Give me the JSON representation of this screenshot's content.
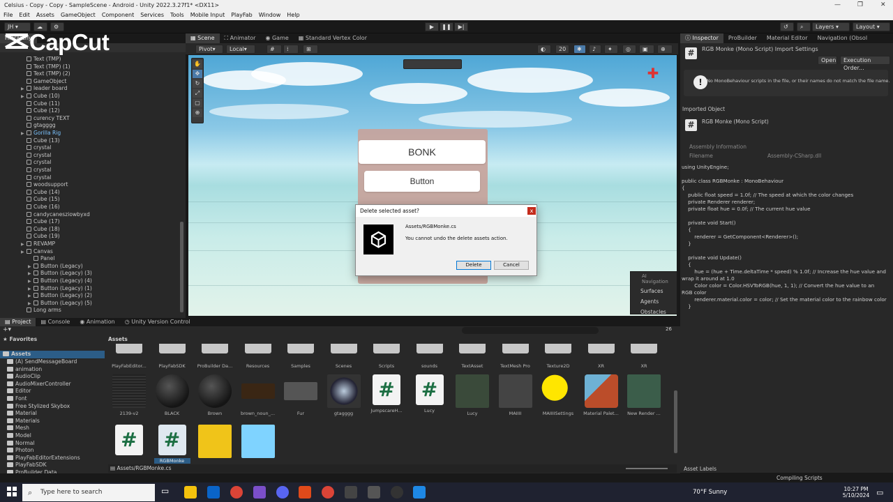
{
  "window": {
    "title": "Celsius - Copy - Copy - SampleScene - Android - Unity 2022.3.27f1* <DX11>"
  },
  "menu": [
    "File",
    "Edit",
    "Assets",
    "GameObject",
    "Component",
    "Services",
    "Tools",
    "Mobile Input",
    "PlayFab",
    "Window",
    "Help"
  ],
  "toolbar": {
    "account": "JH",
    "layers": "Layers",
    "layout": "Layout"
  },
  "overlay_logo": "CapCut",
  "hierarchy": {
    "rows": [
      {
        "label": "Text (TMP)",
        "indent": 1
      },
      {
        "label": "Text (TMP) (1)",
        "indent": 1
      },
      {
        "label": "Text (TMP) (2)",
        "indent": 1
      },
      {
        "label": "GameObject",
        "indent": 1
      },
      {
        "label": "leader board",
        "indent": 1,
        "arrow": true
      },
      {
        "label": "Cube (10)",
        "indent": 1,
        "arrow": true
      },
      {
        "label": "Cube (11)",
        "indent": 1
      },
      {
        "label": "Cube (12)",
        "indent": 1
      },
      {
        "label": "curency TEXT",
        "indent": 1
      },
      {
        "label": "gtagggg",
        "indent": 1
      },
      {
        "label": "Gorilla Rig",
        "indent": 1,
        "arrow": true,
        "highlight": true
      },
      {
        "label": "Cube (13)",
        "indent": 1
      },
      {
        "label": "crystal",
        "indent": 1
      },
      {
        "label": "crystal",
        "indent": 1
      },
      {
        "label": "crystal",
        "indent": 1
      },
      {
        "label": "crystal",
        "indent": 1
      },
      {
        "label": "crystal",
        "indent": 1
      },
      {
        "label": "woodsupport",
        "indent": 1
      },
      {
        "label": "Cube (14)",
        "indent": 1
      },
      {
        "label": "Cube (15)",
        "indent": 1
      },
      {
        "label": "Cube (16)",
        "indent": 1
      },
      {
        "label": "candycanesziowbyxd",
        "indent": 1
      },
      {
        "label": "Cube (17)",
        "indent": 1
      },
      {
        "label": "Cube (18)",
        "indent": 1
      },
      {
        "label": "Cube (19)",
        "indent": 1
      },
      {
        "label": "REVAMP",
        "indent": 1,
        "arrow": true
      },
      {
        "label": "Canvas",
        "indent": 1,
        "arrow": true
      },
      {
        "label": "Panel",
        "indent": 2
      },
      {
        "label": "Button (Legacy)",
        "indent": 2,
        "arrow": true
      },
      {
        "label": "Button (Legacy) (3)",
        "indent": 2,
        "arrow": true
      },
      {
        "label": "Button (Legacy) (4)",
        "indent": 2,
        "arrow": true
      },
      {
        "label": "Button (Legacy) (1)",
        "indent": 2,
        "arrow": true
      },
      {
        "label": "Button (Legacy) (2)",
        "indent": 2,
        "arrow": true
      },
      {
        "label": "Button (Legacy) (5)",
        "indent": 2,
        "arrow": true
      },
      {
        "label": "Long arms",
        "indent": 1
      }
    ]
  },
  "scene": {
    "tabs": [
      "Scene",
      "Animator",
      "Game",
      "Standard Vertex Color"
    ],
    "pivot": "Pivot",
    "local": "Local",
    "zoom": "20",
    "bonk_label": "BONK",
    "button_label": "Button",
    "nav_panel": [
      "AI Navigation",
      "Surfaces",
      "Agents",
      "Obstacles"
    ]
  },
  "dialog": {
    "title": "Delete selected asset?",
    "path": "Assets/RGBMonke.cs",
    "message": "You cannot undo the delete assets action.",
    "delete_label": "Delete",
    "cancel_label": "Cancel",
    "close_glyph": "x"
  },
  "inspector": {
    "tabs": [
      "Inspector",
      "ProBuilder",
      "Material Editor",
      "Navigation (Obsol"
    ],
    "header": "RGB Monke (Mono Script) Import Settings",
    "open_label": "Open",
    "exec_order_label": "Execution Order...",
    "warning": "No MonoBehaviour scripts in the file, or their names do not match the file name.",
    "imported_object": "Imported Object",
    "script_name": "RGB Monke (Mono Script)",
    "assembly_info": "Assembly Information",
    "filename_label": "Filename",
    "filename_value": "Assembly-CSharp.dll",
    "code_lines": [
      "using UnityEngine;",
      "",
      "public class RGBMonke : MonoBehaviour",
      "{",
      "    public float speed = 1.0f; // The speed at which the color changes",
      "    private Renderer renderer;",
      "    private float hue = 0.0f; // The current hue value",
      "",
      "    private void Start()",
      "    {",
      "        renderer = GetComponent<Renderer>();",
      "    }",
      "",
      "    private void Update()",
      "    {",
      "        hue = (hue + Time.deltaTime * speed) % 1.0f; // Increase the hue value and",
      "wrap it around at 1.0",
      "        Color color = Color.HSVToRGB(hue, 1, 1); // Convert the hue value to an",
      "RGB color",
      "        renderer.material.color = color; // Set the material color to the rainbow color",
      "    }"
    ],
    "asset_labels": "Asset Labels"
  },
  "project": {
    "tabs": [
      "Project",
      "Console",
      "Animation",
      "Unity Version Control"
    ],
    "favorites": "Favorites",
    "assets_root": "Assets",
    "breadcrumb": "Assets",
    "hidden_count": "26",
    "tree": [
      "(A) SendMessageBoard",
      "animation",
      "AudioClip",
      "AudioMixerController",
      "Editor",
      "Font",
      "Free Stylized Skybox",
      "Material",
      "Materials",
      "Mesh",
      "Model",
      "Normal",
      "Photon",
      "PlayFabEditorExtensions",
      "PlayFabSDK",
      "ProBuilder Data"
    ],
    "folders_row": [
      "PlayFabEditor...",
      "PlayFabSDK",
      "ProBuilder Da...",
      "Resources",
      "Samples",
      "Scenes",
      "Scripts",
      "sounds",
      "TextAsset",
      "TextMesh Pro",
      "Texture2D",
      "XR",
      "XR"
    ],
    "assets_row": [
      "2139-v2",
      "BLACK",
      "Brown",
      "brown_noun_...",
      "Fur",
      "gtagggg",
      "JumpscareH...",
      "Lucy",
      "Lucy",
      "MAIIII",
      "MAIIIISettings",
      "Material Palet...",
      "New Render ..."
    ],
    "assets_row3": [
      "",
      "RGBMonke",
      "",
      ""
    ],
    "selected_path": "Assets/RGBMonke.cs",
    "status": "Compiling Scripts"
  },
  "taskbar": {
    "search_placeholder": "Type here to search",
    "weather": "70°F  Sunny",
    "time": "10:27 PM",
    "date": "5/10/2024"
  },
  "colors": {
    "unity_dark": "#282828",
    "selection_blue": "#2c5d87",
    "dialog_red": "#c42b1c"
  }
}
